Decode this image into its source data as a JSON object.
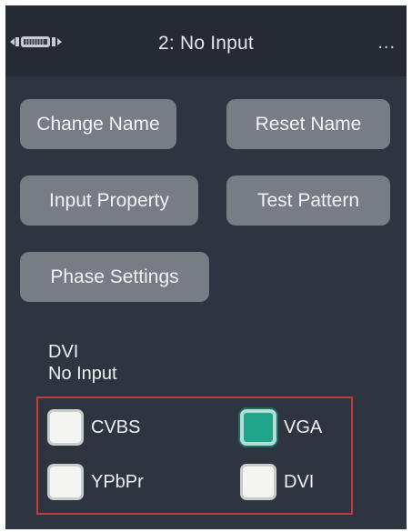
{
  "header": {
    "title": "2: No Input",
    "more": "..."
  },
  "buttons": {
    "change_name": "Change Name",
    "reset_name": "Reset Name",
    "input_property": "Input Property",
    "test_pattern": "Test Pattern",
    "phase_settings": "Phase Settings"
  },
  "status": {
    "signal_type": "DVI",
    "signal_state": "No Input"
  },
  "inputs": {
    "cvbs": {
      "label": "CVBS",
      "checked": false
    },
    "vga": {
      "label": "VGA",
      "checked": true
    },
    "ypbpr": {
      "label": "YPbPr",
      "checked": false
    },
    "dvi": {
      "label": "DVI",
      "checked": false
    }
  },
  "colors": {
    "panel_background": "#2f3441",
    "header_background": "#252a35",
    "button": "#777c85",
    "selected_accent": "#21a48c",
    "group_border": "#c63a3d"
  }
}
